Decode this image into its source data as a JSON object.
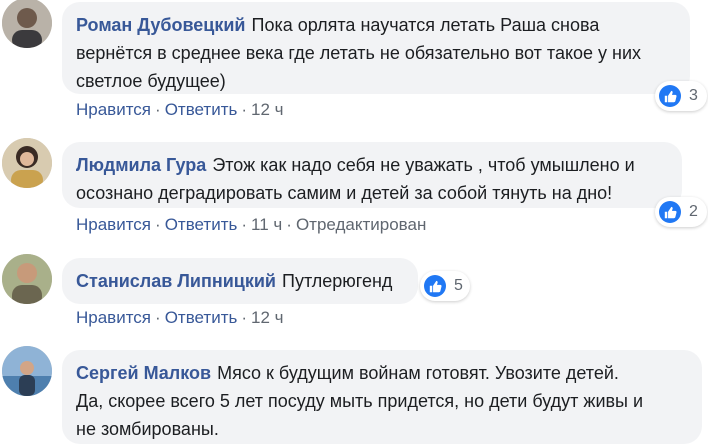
{
  "comments": [
    {
      "author": "Роман Дубовецкий",
      "lines": [
        "Пока орлята научатся летать Раша снова",
        "вернётся в среднее века где летать не обязательно вот такое у них",
        "светлое будущее)"
      ],
      "like_label": "Нравится",
      "reply_label": "Ответить",
      "separator": "·",
      "time": "12 ч",
      "reactions": "3",
      "reaction_icon": "like-icon",
      "avatar_color": "#7a6f66"
    },
    {
      "author": "Людмила Гура",
      "lines": [
        "Этож как надо себя не уважать , чтоб умышлено и",
        "осознано деградировать самим и детей за собой тянуть на дно!"
      ],
      "like_label": "Нравится",
      "reply_label": "Ответить",
      "separator": "·",
      "time": "11 ч",
      "edited": "Отредактирован",
      "reactions": "2",
      "reaction_icon": "like-icon",
      "avatar_color": "#c4a36a"
    },
    {
      "author": "Станислав Липницкий",
      "lines": [
        "Путлерюгенд"
      ],
      "like_label": "Нравится",
      "reply_label": "Ответить",
      "separator": "·",
      "time": "12 ч",
      "reactions": "5",
      "reaction_icon": "like-icon",
      "avatar_color": "#6f7d5a"
    },
    {
      "author": "Сергей Малков",
      "lines": [
        "Мясо к будущим войнам готовят. Увозите детей.",
        "Да, скорее всего 5 лет посуду мыть придется, но дети будут живы и",
        "не зомбированы."
      ],
      "avatar_color": "#5b7fa3"
    }
  ],
  "colors": {
    "author": "#385898",
    "bubble": "#f2f3f5",
    "meta": "#606770",
    "like_badge": "#2078f4"
  }
}
